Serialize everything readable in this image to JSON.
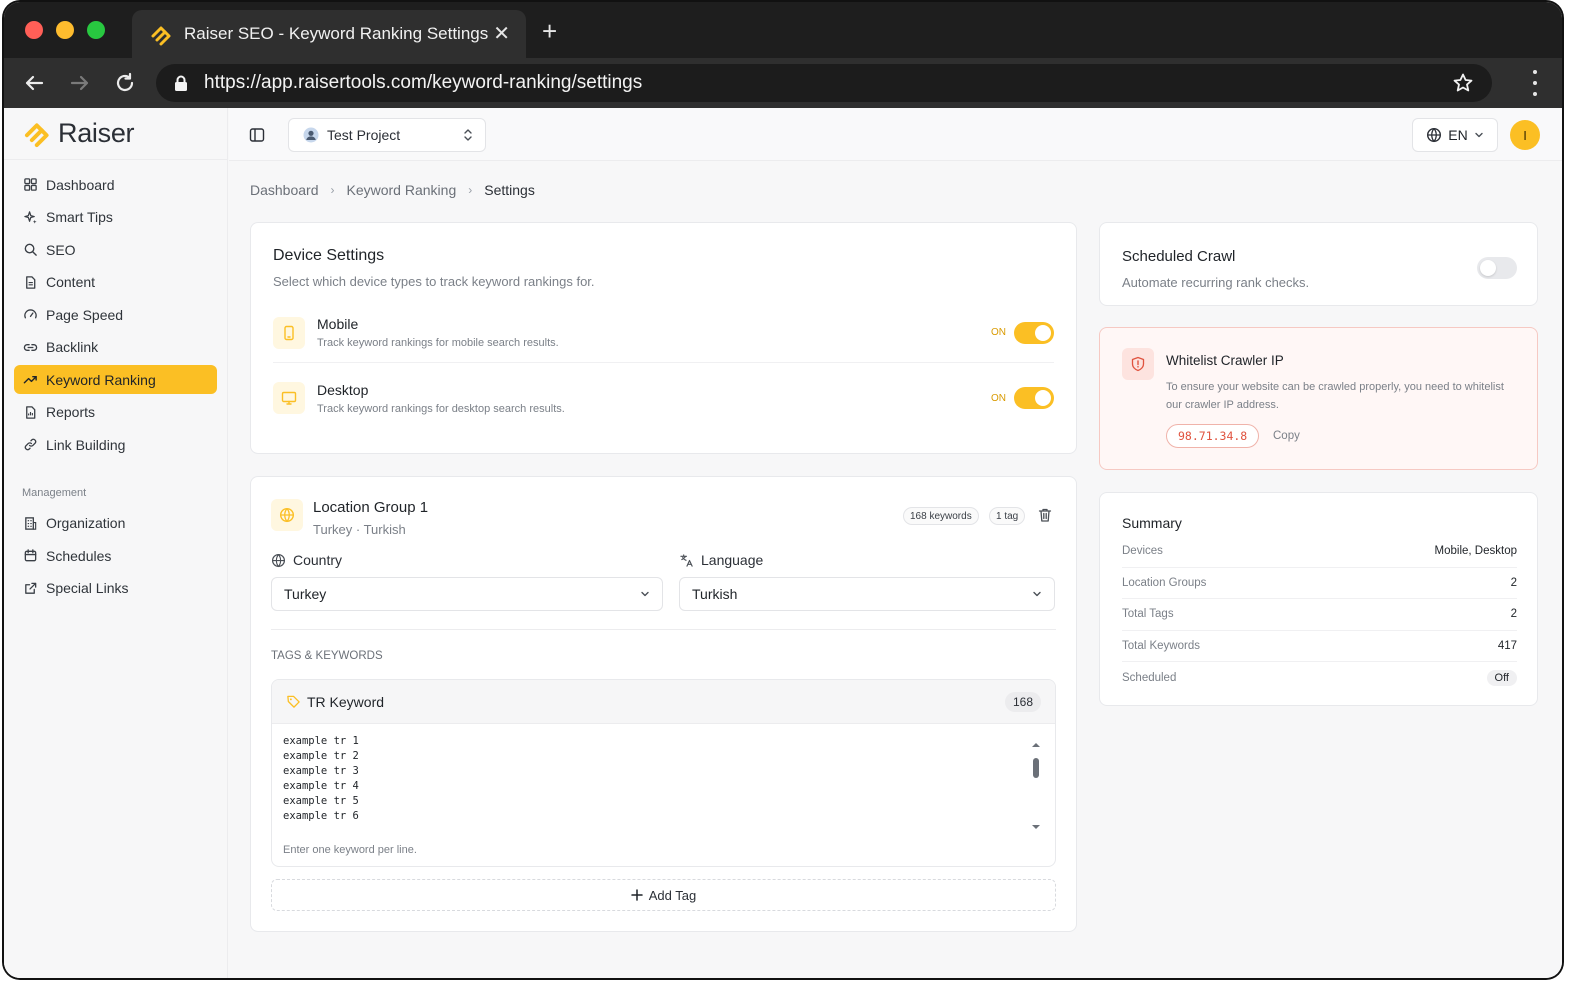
{
  "browser": {
    "tab_title": "Raiser SEO - Keyword Ranking Settings",
    "url": "https://app.raisertools.com/keyword-ranking/settings"
  },
  "brand": {
    "name": "Raiser",
    "color": "#fbbf24"
  },
  "sidebar": {
    "items": [
      {
        "label": "Dashboard",
        "icon": "grid-icon"
      },
      {
        "label": "Smart Tips",
        "icon": "sparkles-icon"
      },
      {
        "label": "SEO",
        "icon": "search-icon"
      },
      {
        "label": "Content",
        "icon": "document-icon"
      },
      {
        "label": "Page Speed",
        "icon": "gauge-icon"
      },
      {
        "label": "Backlink",
        "icon": "link-icon"
      },
      {
        "label": "Keyword Ranking",
        "icon": "trending-up-icon",
        "active": true
      },
      {
        "label": "Reports",
        "icon": "report-icon"
      },
      {
        "label": "Link Building",
        "icon": "chain-icon"
      }
    ],
    "management_title": "Management",
    "management_items": [
      {
        "label": "Organization",
        "icon": "building-icon"
      },
      {
        "label": "Schedules",
        "icon": "calendar-icon"
      },
      {
        "label": "Special Links",
        "icon": "external-link-icon"
      }
    ]
  },
  "topbar": {
    "project": "Test Project",
    "language": "EN",
    "avatar_initial": "I"
  },
  "breadcrumb": [
    "Dashboard",
    "Keyword Ranking",
    "Settings"
  ],
  "device_settings": {
    "title": "Device Settings",
    "subtitle": "Select which device types to track keyword rankings for.",
    "devices": [
      {
        "name": "Mobile",
        "desc": "Track keyword rankings for mobile search results.",
        "state": "ON"
      },
      {
        "name": "Desktop",
        "desc": "Track keyword rankings for desktop search results.",
        "state": "ON"
      }
    ]
  },
  "location_group": {
    "title": "Location Group 1",
    "subtitle": "Turkey · Turkish",
    "keywords_badge": "168 keywords",
    "tags_badge": "1 tag",
    "country_label": "Country",
    "country_value": "Turkey",
    "language_label": "Language",
    "language_value": "Turkish",
    "section_title": "TAGS & KEYWORDS",
    "tag": {
      "name": "TR Keyword",
      "count": "168",
      "keywords": "example tr 1\nexample tr 2\nexample tr 3\nexample tr 4\nexample tr 5\nexample tr 6",
      "hint": "Enter one keyword per line."
    },
    "add_tag": "Add Tag"
  },
  "scheduled_crawl": {
    "title": "Scheduled Crawl",
    "subtitle": "Automate recurring rank checks.",
    "enabled": false
  },
  "whitelist": {
    "title": "Whitelist Crawler IP",
    "desc": "To ensure your website can be crawled properly, you need to whitelist our crawler IP address.",
    "ip": "98.71.34.8",
    "copy": "Copy"
  },
  "summary": {
    "title": "Summary",
    "rows": [
      {
        "key": "Devices",
        "value": "Mobile, Desktop"
      },
      {
        "key": "Location Groups",
        "value": "2"
      },
      {
        "key": "Total Tags",
        "value": "2"
      },
      {
        "key": "Total Keywords",
        "value": "417"
      },
      {
        "key": "Scheduled",
        "value": "Off"
      }
    ]
  }
}
